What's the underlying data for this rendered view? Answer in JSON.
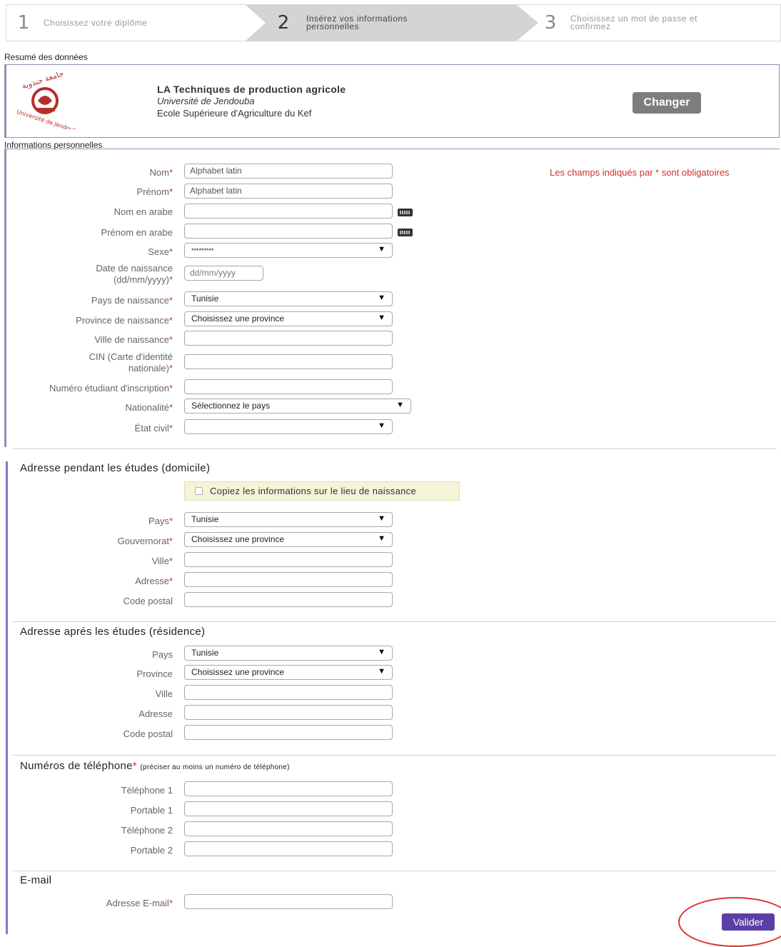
{
  "steps": [
    {
      "num": "1",
      "label_l1": "Choisissez votre diplôme",
      "label_l2": ""
    },
    {
      "num": "2",
      "label_l1": "Insérez vos informations",
      "label_l2": "personnelles"
    },
    {
      "num": "3",
      "label_l1": "Choisissez un mot de passe et",
      "label_l2": "confirmez"
    }
  ],
  "summary": {
    "caption": "Resumé des données",
    "diploma": "LA Techniques de production agricole",
    "university": "Université de Jendouba",
    "school": "Ecole Supérieure d'Agriculture du Kef",
    "logo_text_ar": "جامعة جندوبة",
    "logo_text_fr": "Université de Jendouba",
    "change_button": "Changer"
  },
  "personal": {
    "caption": "Informations personnelles",
    "required_note": "Les champs indiqués par * sont obligatoires",
    "fields": {
      "nom": {
        "label": "Nom",
        "req": "*",
        "value": "Alphabet latin"
      },
      "prenom": {
        "label": "Prénom",
        "req": "*",
        "value": "Alphabet latin"
      },
      "nom_ar": {
        "label": "Nom en arabe",
        "req": "",
        "value": ""
      },
      "prenom_ar": {
        "label": "Prénom en arabe",
        "req": "",
        "value": ""
      },
      "sexe": {
        "label": "Sexe",
        "req": "*",
        "value": "*********"
      },
      "date_l1": "Date de naissance",
      "date_l2": "(dd/mm/yyyy)",
      "date_req": "*",
      "date_placeholder": "dd/mm/yyyy",
      "pays_naiss": {
        "label": "Pays de naissance",
        "req": "*",
        "value": "Tunisie"
      },
      "prov_naiss": {
        "label": "Province de naissance",
        "req": "*",
        "value": "Choisissez une province"
      },
      "ville_naiss": {
        "label": "Ville de naissance",
        "req": "*",
        "value": ""
      },
      "cin_l1": "CIN (Carte d'identité",
      "cin_l2": "nationale)",
      "cin_req": "*",
      "num_etud": {
        "label": "Numéro étudiant d'inscription",
        "req": "*",
        "value": ""
      },
      "nationalite": {
        "label": "Nationalité",
        "req": "*",
        "value": "Sélectionnez le pays"
      },
      "etat_civil": {
        "label": "État civil",
        "req": "*",
        "value": ""
      }
    }
  },
  "domicile": {
    "title": "Adresse pendant les études (domicile)",
    "copy_label": "Copiez les informations sur le lieu de naissance",
    "pays": {
      "label": "Pays",
      "req": "*",
      "value": "Tunisie"
    },
    "gouv": {
      "label": "Gouvernorat",
      "req": "*",
      "value": "Choisissez une province"
    },
    "ville": {
      "label": "Ville",
      "req": "*"
    },
    "adresse": {
      "label": "Adresse",
      "req": "*"
    },
    "cp": {
      "label": "Code postal"
    }
  },
  "residence": {
    "title": "Adresse aprés les études (résidence)",
    "pays": {
      "label": "Pays",
      "value": "Tunisie"
    },
    "province": {
      "label": "Province",
      "value": "Choisissez une province"
    },
    "ville": {
      "label": "Ville"
    },
    "adresse": {
      "label": "Adresse"
    },
    "cp": {
      "label": "Code postal"
    }
  },
  "phones": {
    "title": "Numéros de téléphone",
    "req": "*",
    "hint": "(préciser au moins un numéro de téléphone)",
    "tel1": "Téléphone 1",
    "port1": "Portable 1",
    "tel2": "Téléphone 2",
    "port2": "Portable 2"
  },
  "email": {
    "title": "E-mail",
    "label": "Adresse E-mail",
    "req": "*"
  },
  "submit_button": "Valider",
  "colors": {
    "accent": "#5a3fa6",
    "required": "#d0312d",
    "annotation": "#e03030"
  }
}
